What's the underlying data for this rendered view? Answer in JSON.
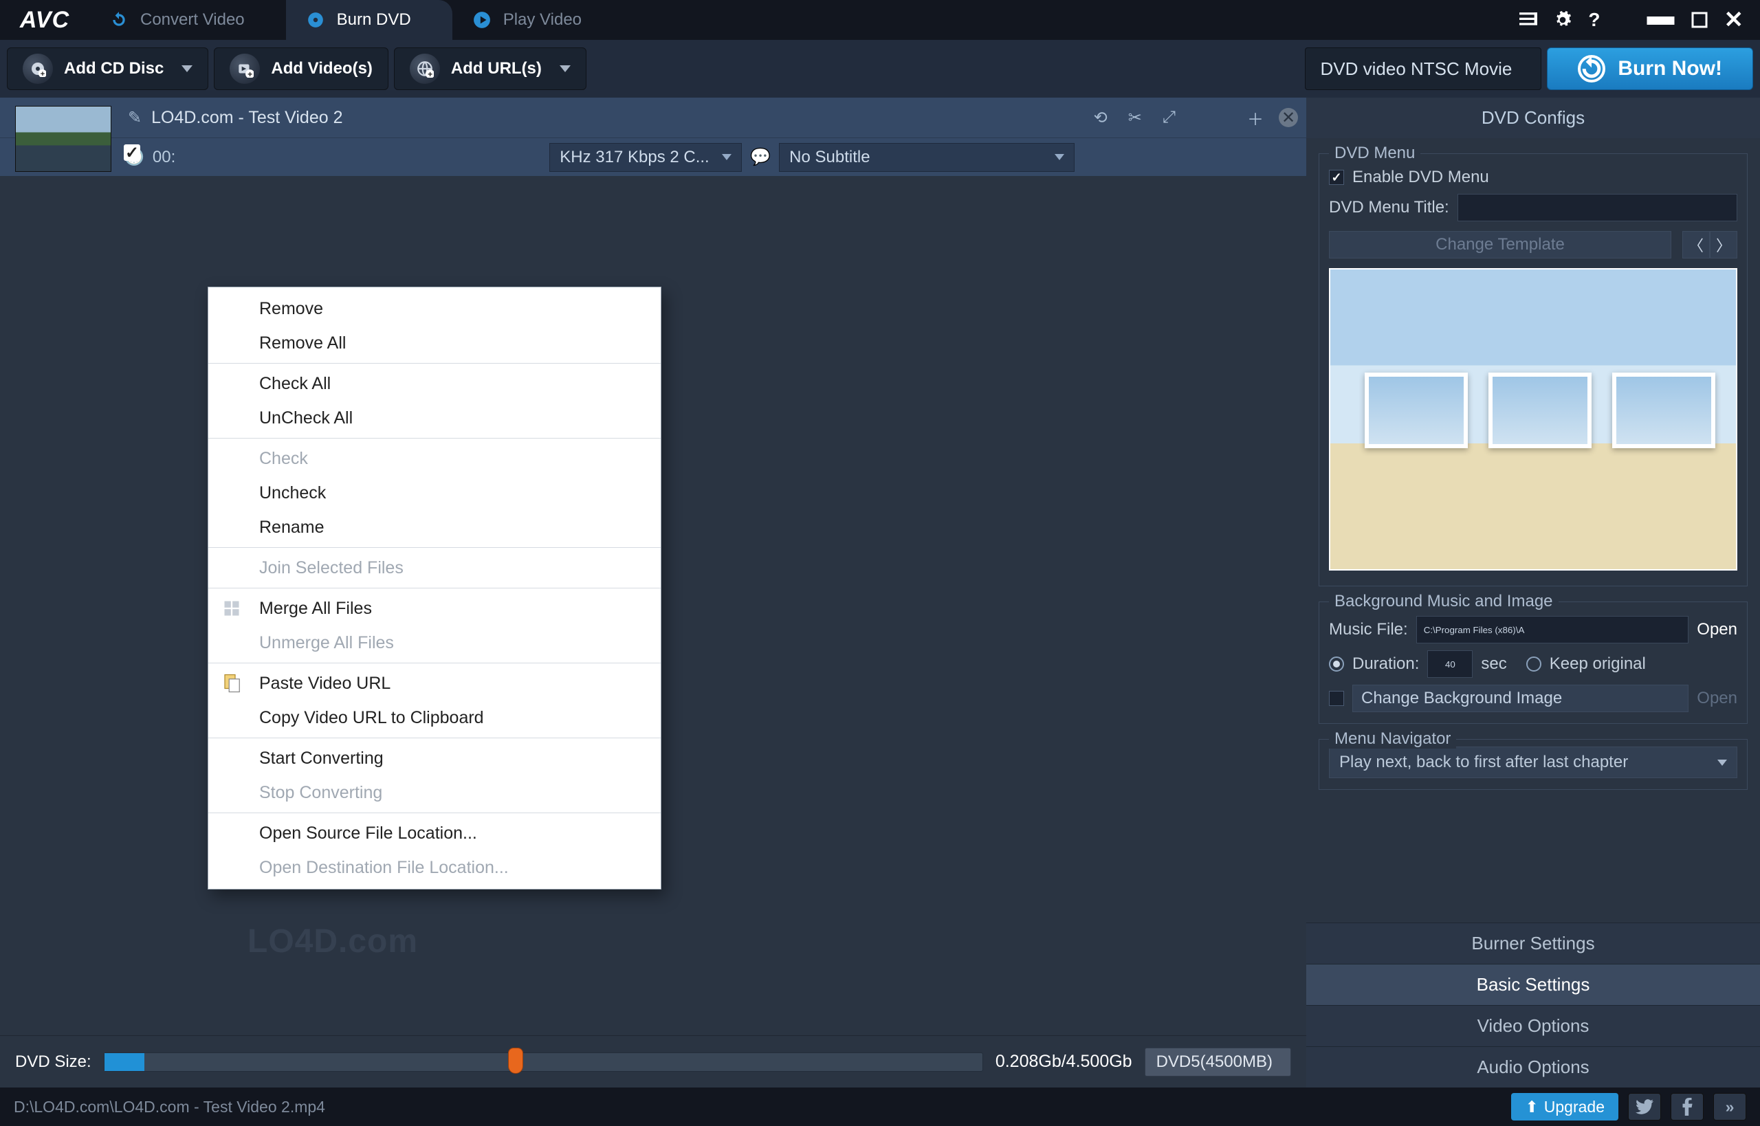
{
  "tabs": {
    "convert": "Convert Video",
    "burn": "Burn DVD",
    "play": "Play Video"
  },
  "toolbar": {
    "add_disc": "Add CD Disc",
    "add_videos": "Add Video(s)",
    "add_urls": "Add URL(s)"
  },
  "profile": "DVD video NTSC Movie",
  "burn_label": "Burn Now!",
  "item": {
    "title": "LO4D.com - Test Video 2",
    "time": "00:",
    "audio": "KHz 317 Kbps 2 C...",
    "subtitle": "No Subtitle"
  },
  "context_menu": [
    {
      "label": "Remove",
      "enabled": true
    },
    {
      "label": "Remove All",
      "enabled": true
    },
    {
      "sep": true
    },
    {
      "label": "Check All",
      "enabled": true
    },
    {
      "label": "UnCheck All",
      "enabled": true
    },
    {
      "sep": true
    },
    {
      "label": "Check",
      "enabled": false
    },
    {
      "label": "Uncheck",
      "enabled": true
    },
    {
      "label": "Rename",
      "enabled": true
    },
    {
      "sep": true
    },
    {
      "label": "Join Selected Files",
      "enabled": false
    },
    {
      "sep": true
    },
    {
      "label": "Merge All Files",
      "enabled": true,
      "icon": "merge"
    },
    {
      "label": "Unmerge All Files",
      "enabled": false
    },
    {
      "sep": true
    },
    {
      "label": "Paste Video URL",
      "enabled": true,
      "icon": "paste"
    },
    {
      "label": "Copy Video URL to Clipboard",
      "enabled": true
    },
    {
      "sep": true
    },
    {
      "label": "Start Converting",
      "enabled": true
    },
    {
      "label": "Stop Converting",
      "enabled": false
    },
    {
      "sep": true
    },
    {
      "label": "Open Source File Location...",
      "enabled": true
    },
    {
      "label": "Open Destination File Location...",
      "enabled": false
    }
  ],
  "dvd_size": {
    "label": "DVD Size:",
    "value": "0.208Gb/4.500Gb",
    "disc": "DVD5(4500MB)"
  },
  "side": {
    "header": "DVD Configs",
    "menu": {
      "legend": "DVD Menu",
      "enable": "Enable DVD Menu",
      "title_lbl": "DVD Menu Title:",
      "title_val": "",
      "change_tpl": "Change Template"
    },
    "bg": {
      "legend": "Background Music and Image",
      "music_lbl": "Music File:",
      "music_val": "C:\\Program Files (x86)\\A",
      "open": "Open",
      "dur_lbl": "Duration:",
      "dur_val": "40",
      "dur_unit": "sec",
      "keep": "Keep original",
      "chg_img": "Change Background Image",
      "open2": "Open"
    },
    "nav": {
      "legend": "Menu Navigator",
      "value": "Play next, back to first after last chapter"
    },
    "acc": [
      "Burner Settings",
      "Basic Settings",
      "Video Options",
      "Audio Options"
    ]
  },
  "status": {
    "path": "D:\\LO4D.com\\LO4D.com - Test Video 2.mp4",
    "upgrade": "Upgrade"
  }
}
